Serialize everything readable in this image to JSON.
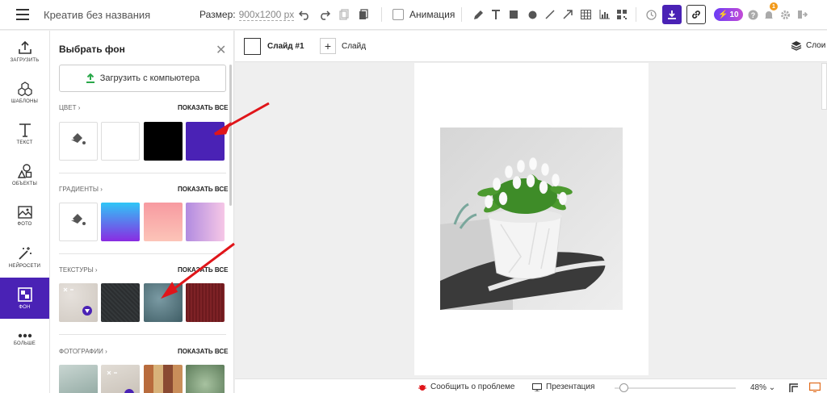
{
  "topbar": {
    "title": "Креатив без названия",
    "size_label": "Размер:",
    "size_value": "900x1200 px",
    "animation_label": "Анимация",
    "credits": "10",
    "notifications": "1",
    "accent": "#4a22b5"
  },
  "left_nav": [
    {
      "label": "Загрузить",
      "icon": "upload-icon"
    },
    {
      "label": "Шаблоны",
      "icon": "templates-icon"
    },
    {
      "label": "Текст",
      "icon": "text-icon"
    },
    {
      "label": "Объекты",
      "icon": "shapes-icon"
    },
    {
      "label": "Фото",
      "icon": "photo-icon"
    },
    {
      "label": "Нейросети",
      "icon": "magic-wand-icon"
    },
    {
      "label": "Фон",
      "icon": "background-icon",
      "active": true
    },
    {
      "label": "Больше",
      "icon": "more-icon"
    }
  ],
  "panel": {
    "title": "Выбрать фон",
    "upload_label": "Загрузить с компьютера",
    "show_all": "ПОКАЗАТЬ ВСЕ",
    "sections": {
      "color": "ЦВЕТ",
      "gradients": "ГРАДИЕНТЫ",
      "textures": "ТЕКСТУРЫ",
      "photos": "ФОТОГРАФИИ"
    },
    "colors": [
      "#ffffff",
      "#000000",
      "#4a22b5"
    ]
  },
  "slide_bar": {
    "slide_name": "Слайд #1",
    "add_slide": "Слайд",
    "layers": "Слои"
  },
  "bottom_bar": {
    "report": "Сообщить о проблеме",
    "presentation": "Презентация",
    "zoom": "48%",
    "zoom_level": 0.05
  }
}
